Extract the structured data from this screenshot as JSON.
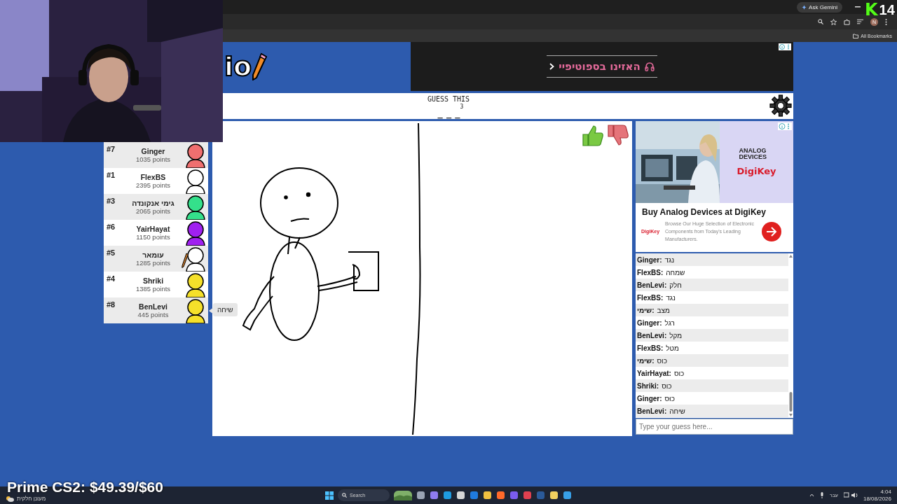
{
  "stream_overlay": {
    "kick_logo": "K",
    "counter": "14",
    "goal": "Prime CS2: $49.39/$60"
  },
  "browser": {
    "gemini_button": "Ask Gemini",
    "profile": "N",
    "bookmarks": "All Bookmarks"
  },
  "game": {
    "logo": "io",
    "banner_ad": {
      "text": "האזינו בספוטיפיי"
    },
    "header": {
      "title": "GUESS THIS",
      "count": "3",
      "hint": "_ _ _"
    },
    "players": [
      {
        "rank": "#7",
        "name": "Ginger",
        "points": "1035 points",
        "color": "#ef6f6f",
        "drawing": false
      },
      {
        "rank": "#1",
        "name": "FlexBS",
        "points": "2395 points",
        "color": "#ffffff",
        "drawing": false
      },
      {
        "rank": "#3",
        "name": "גימי אנקונדה",
        "points": "2065 points",
        "color": "#34e08b",
        "drawing": false
      },
      {
        "rank": "#6",
        "name": "YairHayat",
        "points": "1150 points",
        "color": "#a020f0",
        "drawing": false
      },
      {
        "rank": "#5",
        "name": "עומאר",
        "points": "1285 points",
        "color": "#ffffff",
        "drawing": true
      },
      {
        "rank": "#4",
        "name": "Shriki",
        "points": "1385 points",
        "color": "#f5e02a",
        "drawing": false
      },
      {
        "rank": "#8",
        "name": "BenLevi",
        "points": "445 points",
        "color": "#f5e02a",
        "drawing": false
      }
    ],
    "tooltip": "שיחה",
    "side_ad": {
      "brand": "ANALOG DEVICES",
      "brand_logo": "DigiKey",
      "headline": "Buy Analog Devices at DigiKey",
      "sponsor": "DigiKey",
      "body": "Browse Our Huge Selection of Electronic Components from Today's Leading Manufacturers."
    },
    "chat": [
      {
        "name": "Ginger:",
        "text": "נגד"
      },
      {
        "name": "FlexBS:",
        "text": "שמחה"
      },
      {
        "name": "BenLevi:",
        "text": "חלק"
      },
      {
        "name": "FlexBS:",
        "text": "נגד"
      },
      {
        "name": "שימי:",
        "text": "מצב"
      },
      {
        "name": "Ginger:",
        "text": "רגל"
      },
      {
        "name": "BenLevi:",
        "text": "מקל"
      },
      {
        "name": "FlexBS:",
        "text": "מטל"
      },
      {
        "name": "שימי:",
        "text": "כוס"
      },
      {
        "name": "YairHayat:",
        "text": "כוס"
      },
      {
        "name": "Shriki:",
        "text": "כוס"
      },
      {
        "name": "Ginger:",
        "text": "כוּס"
      },
      {
        "name": "BenLevi:",
        "text": "שיחה"
      }
    ],
    "guess_input": {
      "placeholder": "Type your guess here..."
    }
  },
  "taskbar": {
    "weather": "מעונן חלקית",
    "search": "Search",
    "language": "עבר",
    "time": "4:04",
    "date": "18/08/2026"
  }
}
